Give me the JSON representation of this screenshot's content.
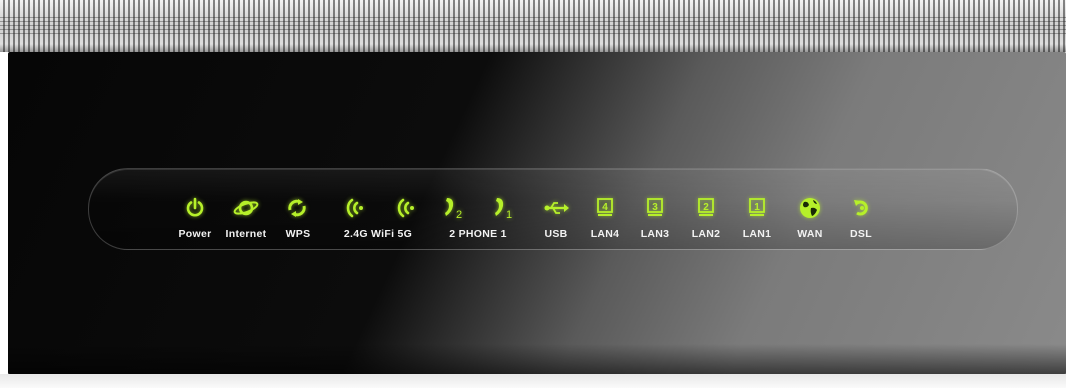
{
  "colors": {
    "led_green": "#b6f02a",
    "label_white": "#f2f2f2"
  },
  "indicators": [
    {
      "icon": "power-icon",
      "label": "Power"
    },
    {
      "icon": "internet-icon",
      "label": "Internet"
    },
    {
      "icon": "wps-icon",
      "label": "WPS"
    },
    {
      "icon": "wifi-2-4g-icon",
      "label": ""
    },
    {
      "icon": "wifi-5g-icon",
      "label": ""
    },
    {
      "icon": "phone-2-icon",
      "label": ""
    },
    {
      "icon": "phone-1-icon",
      "label": ""
    },
    {
      "icon": "usb-icon",
      "label": "USB"
    },
    {
      "icon": "lan4-icon",
      "label": "LAN4"
    },
    {
      "icon": "lan3-icon",
      "label": "LAN3"
    },
    {
      "icon": "lan2-icon",
      "label": "LAN2"
    },
    {
      "icon": "lan1-icon",
      "label": "LAN1"
    },
    {
      "icon": "wan-icon",
      "label": "WAN"
    },
    {
      "icon": "dsl-icon",
      "label": "DSL"
    }
  ],
  "group_labels": {
    "wifi": "2.4G WiFi 5G",
    "phone": "2 PHONE 1"
  },
  "port_numbers": {
    "lan4": "4",
    "lan3": "3",
    "lan2": "2",
    "lan1": "1",
    "phone2": "2",
    "phone1": "1"
  }
}
